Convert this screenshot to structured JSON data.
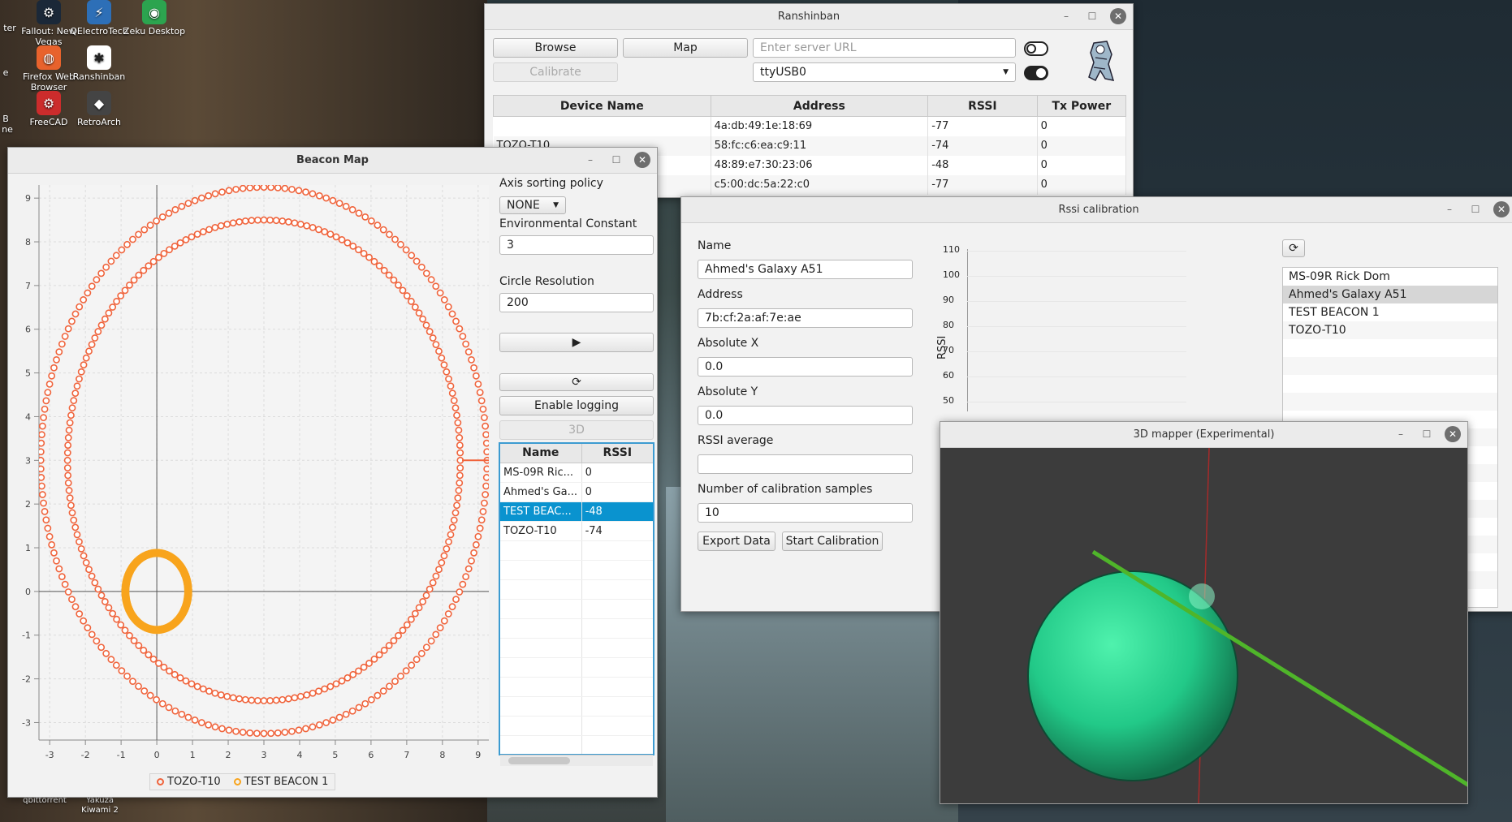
{
  "desktop": {
    "icons": [
      {
        "label": "Fallout: New Vegas",
        "icon": "steam-icon",
        "color": "#1b2838"
      },
      {
        "label": "QElectroTech",
        "icon": "lightning-icon",
        "color": "#2d6fb7"
      },
      {
        "label": "Zeku Desktop",
        "icon": "zeku-icon",
        "color": "#2ca44f"
      },
      {
        "label": "Firefox Web Browser",
        "icon": "firefox-icon",
        "color": "#e8622c"
      },
      {
        "label": "Ranshinban",
        "icon": "ranshinban-icon",
        "color": "#ffffff"
      },
      {
        "label": "FreeCAD",
        "icon": "freecad-icon",
        "color": "#cc2c2c"
      },
      {
        "label": "RetroArch",
        "icon": "retroarch-icon",
        "color": "#444444"
      }
    ],
    "partial_labels": {
      "l1": "ter",
      "l2": "e",
      "l3": "B",
      "l4": "ne"
    },
    "bottom_labels": {
      "b1": "qbittorrent",
      "b2": "Yakuza",
      "b3": "Kiwami 2"
    }
  },
  "ranshinban": {
    "title": "Ranshinban",
    "browse_label": "Browse",
    "map_label": "Map",
    "calibrate_label": "Calibrate",
    "server_placeholder": "Enter server URL",
    "port_value": "ttyUSB0",
    "table": {
      "headers": [
        "Device Name",
        "Address",
        "RSSI",
        "Tx Power"
      ],
      "rows": [
        [
          "",
          "4a:db:49:1e:18:69",
          "-77",
          "0"
        ],
        [
          "TOZO-T10",
          "58:fc:c6:ea:c9:11",
          "-74",
          "0"
        ],
        [
          "",
          "48:89:e7:30:23:06",
          "-48",
          "0"
        ],
        [
          "",
          "c5:00:dc:5a:22:c0",
          "-77",
          "0"
        ]
      ]
    }
  },
  "beacon_map": {
    "title": "Beacon Map",
    "axis_sorting_label": "Axis sorting policy",
    "axis_sorting_value": "NONE",
    "env_constant_label": "Environmental Constant",
    "env_constant_value": "3",
    "circle_res_label": "Circle Resolution",
    "circle_res_value": "200",
    "play_label": "▶",
    "refresh_label": "⟳",
    "logging_label": "Enable logging",
    "threed_label": "3D",
    "table": {
      "headers": [
        "Name",
        "RSSI"
      ],
      "rows": [
        [
          "MS-09R Ric...",
          "0"
        ],
        [
          "Ahmed's Ga...",
          "0"
        ],
        [
          "TEST BEAC...",
          "-48"
        ],
        [
          "TOZO-T10",
          "-74"
        ]
      ],
      "selected_row": 2
    }
  },
  "chart_data": {
    "type": "scatter",
    "x_ticks": [
      "-3",
      "-2",
      "-1",
      "0",
      "1",
      "2",
      "3",
      "4",
      "5",
      "6",
      "7",
      "8",
      "9"
    ],
    "y_ticks": [
      "-3",
      "-2",
      "-1",
      "0",
      "1",
      "2",
      "3",
      "4",
      "5",
      "6",
      "7",
      "8",
      "9"
    ],
    "xlim": [
      -3.3,
      9.3
    ],
    "ylim": [
      -3.4,
      9.3
    ],
    "grid": true,
    "legend": "bottom",
    "series": [
      {
        "name": "TOZO-T10",
        "color": "#f0643c",
        "rings": [
          {
            "cx": 3.0,
            "cy": 3.0,
            "r": 6.25
          },
          {
            "cx": 3.0,
            "cy": 3.0,
            "r": 5.5
          }
        ]
      },
      {
        "name": "TEST BEACON 1",
        "color": "#f8a41d",
        "rings": [
          {
            "cx": 0.0,
            "cy": 0.0,
            "r": 0.88
          }
        ]
      }
    ]
  },
  "rssi": {
    "title": "Rssi calibration",
    "name_label": "Name",
    "name_value": "Ahmed's Galaxy A51",
    "address_label": "Address",
    "address_value": "7b:cf:2a:af:7e:ae",
    "abs_x_label": "Absolute X",
    "abs_x_value": "0.0",
    "abs_y_label": "Absolute Y",
    "abs_y_value": "0.0",
    "rssi_avg_label": "RSSI average",
    "rssi_avg_value": "",
    "samples_label": "Number of calibration samples",
    "samples_value": "10",
    "export_label": "Export Data",
    "start_label": "Start Calibration",
    "y_axis_label": "RSSI",
    "y_ticks": [
      "110",
      "100",
      "90",
      "80",
      "70",
      "60",
      "50"
    ],
    "refresh_label": "⟳",
    "devices": [
      "MS-09R Rick Dom",
      "Ahmed's Galaxy A51",
      "TEST BEACON 1",
      "TOZO-T10"
    ],
    "selected_device": 1
  },
  "mapper": {
    "title": "3D mapper (Experimental)",
    "sphere_color": "#2ad38f",
    "background": "#3c3c3c"
  }
}
